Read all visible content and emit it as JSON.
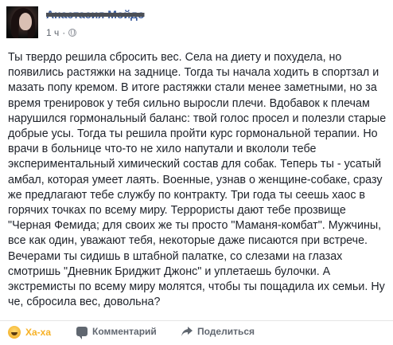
{
  "post": {
    "author_name": "Анастасия Мойдо",
    "timestamp": "1 ч",
    "separator": "·",
    "privacy_icon": "globe-icon",
    "lines": [
      "Ты твердо решила сбросить вес. Села на диету и похудела, но",
      "появились растяжки на заднице. Тогда ты начала ходить в спортзал и",
      "мазать попу кремом. В итоге растяжки стали менее заметными, но за",
      "время тренировок у тебя сильно выросли плечи. Вдобавок к плечам",
      "нарушился гормональный баланс: твой голос просел и полезли старые",
      "добрые усы. Тогда ты решила пройти курс гормональной терапии. Но",
      "врачи в больнице что-то не хило напутали и вкололи тебе",
      "экспериментальный химический состав для собак. Теперь ты - усатый",
      "амбал, которая умеет лаять. Военные, узнав о женщине-собаке, сразу",
      "же предлагают тебе службу по контракту. Три года ты сеешь хаос в",
      "горячих точках по всему миру. Террористы дают тебе прозвище",
      "\"Черная Фемида; для своих же ты просто \"Маманя-комбат\". Мужчины,",
      "все как один, уважают тебя, некоторые даже писаются при встрече.",
      "Вечерами ты сидишь в штабной палатке, со слезами на глазах",
      "смотришь \"Дневник Бриджит Джонс\" и уплетаешь булочки. А",
      "экстремисты по всему миру молятся, чтобы ты пощадила их семьи. Ну",
      "че, сбросила вес, довольна?"
    ]
  },
  "actions": {
    "reaction_label": "Ха-ха",
    "comment_label": "Комментарий",
    "share_label": "Поделиться"
  },
  "colors": {
    "name": "#365899",
    "reaction": "#f7b125",
    "muted": "#616770"
  }
}
